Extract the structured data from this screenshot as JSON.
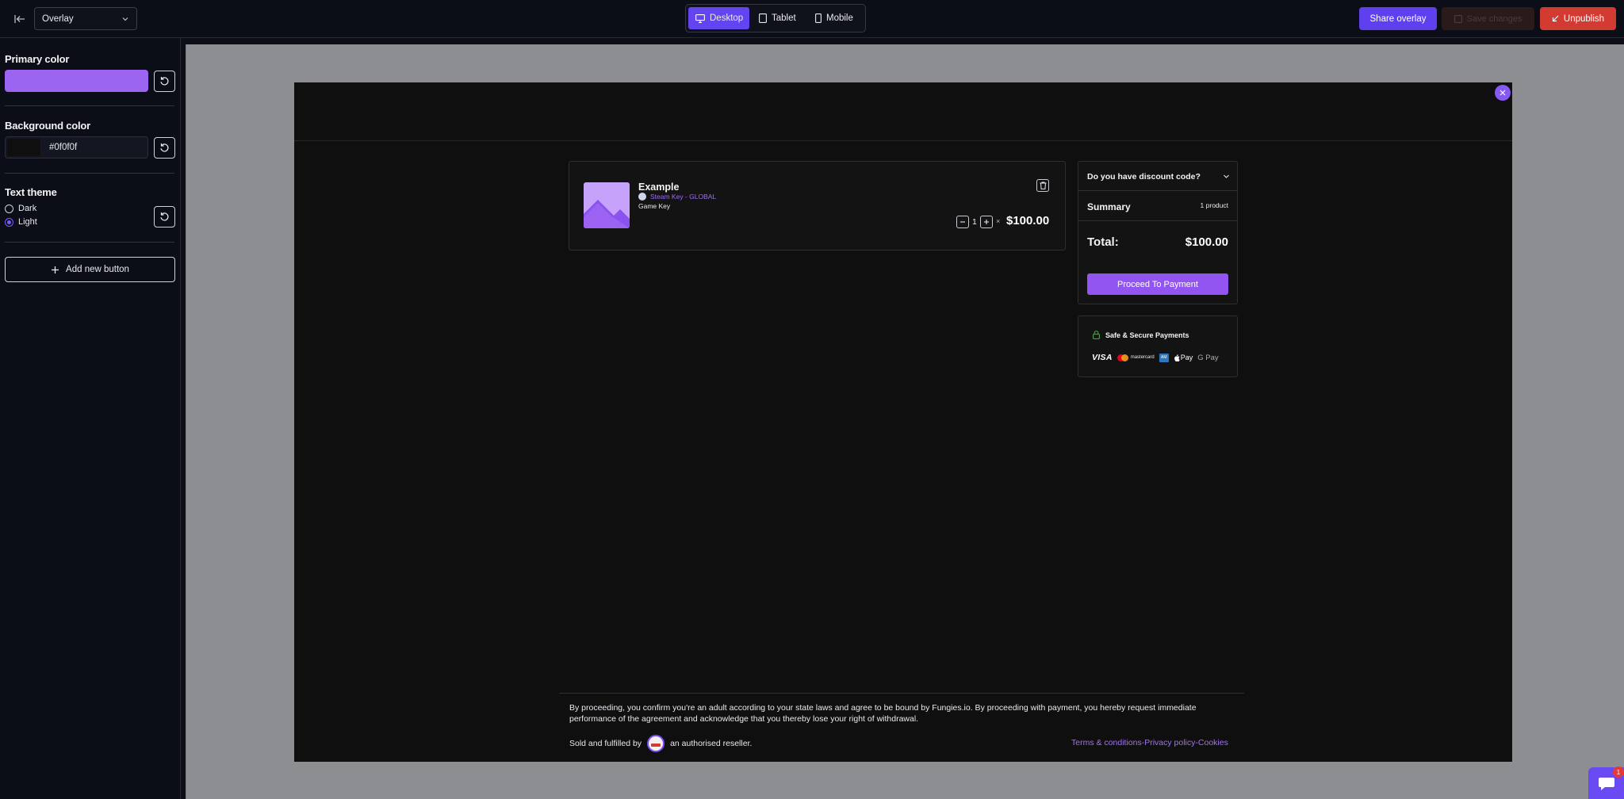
{
  "topbar": {
    "mode_select": "Overlay",
    "devices": [
      {
        "label": "Desktop",
        "icon": "monitor-icon",
        "active": true
      },
      {
        "label": "Tablet",
        "icon": "tablet-icon",
        "active": false
      },
      {
        "label": "Mobile",
        "icon": "mobile-icon",
        "active": false
      }
    ],
    "share_label": "Share overlay",
    "save_label": "Save changes",
    "unpublish_label": "Unpublish"
  },
  "sidebar": {
    "primary_color_title": "Primary color",
    "primary_color_value": "#9b65f2",
    "background_color_title": "Background color",
    "background_color_value": "#0f0f0f",
    "text_theme_title": "Text theme",
    "theme_options": [
      "Dark",
      "Light"
    ],
    "theme_selected": "Light",
    "add_button_label": "Add new button"
  },
  "preview": {
    "product": {
      "name": "Example",
      "platform": "Steam Key - GLOBAL",
      "type": "Game Key",
      "quantity": "1",
      "times": "×",
      "price": "$100.00"
    },
    "summary": {
      "discount_label": "Do you have discount code?",
      "summary_label": "Summary",
      "product_count": "1 product",
      "total_label": "Total:",
      "total_value": "$100.00",
      "pay_button": "Proceed To Payment"
    },
    "secure": {
      "title": "Safe & Secure Payments",
      "methods": [
        "VISA",
        "mastercard",
        "Amex",
        "Apple Pay",
        "G Pay"
      ],
      "mc_text": "mastercard",
      "applepay_text": "Pay",
      "gpay_text": "G Pay"
    },
    "footer": {
      "legal": "By proceeding, you confirm you're an adult according to your state laws and agree to be bound by Fungies.io. By proceeding with payment, you hereby request immediate performance of the agreement and acknowledge that you thereby lose your right of withdrawal.",
      "sold_prefix": "Sold and fulfilled by",
      "sold_suffix": "an authorised reseller.",
      "terms": "Terms & conditions",
      "privacy": "Privacy policy",
      "cookies": "Cookies",
      "separator": "-"
    }
  },
  "chat_badge": "1",
  "colors": {
    "accent": "#6344f0",
    "primary": "#9b65f2",
    "danger": "#d33a31",
    "background": "#0f0f0f"
  }
}
